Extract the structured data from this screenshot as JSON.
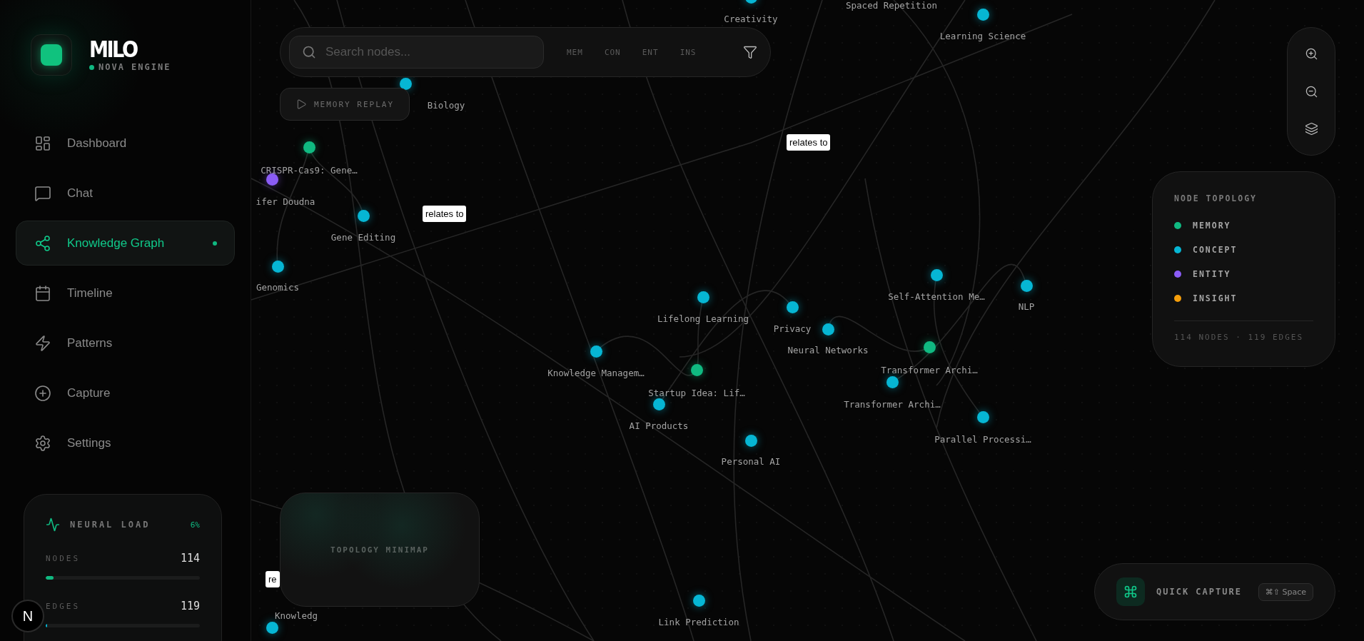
{
  "brand": {
    "title": "MILO",
    "subtitle": "NOVA ENGINE"
  },
  "nav": [
    {
      "label": "Dashboard",
      "selected": false
    },
    {
      "label": "Chat",
      "selected": false
    },
    {
      "label": "Knowledge Graph",
      "selected": true
    },
    {
      "label": "Timeline",
      "selected": false
    },
    {
      "label": "Patterns",
      "selected": false
    },
    {
      "label": "Capture",
      "selected": false
    },
    {
      "label": "Settings",
      "selected": false
    }
  ],
  "neural_load": {
    "title": "NEURAL LOAD",
    "percent": "6%",
    "meters": [
      {
        "label": "NODES",
        "value": "114",
        "level": 0.05,
        "color": "#10b981"
      },
      {
        "label": "EDGES",
        "value": "119",
        "level": 0.01,
        "color": "#06b6d4"
      }
    ]
  },
  "dev_badge": "N",
  "search": {
    "placeholder": "Search nodes..."
  },
  "filters": [
    "MEM",
    "CON",
    "ENT",
    "INS"
  ],
  "replay_button": "MEMORY REPLAY",
  "graph": {
    "nodes": [
      {
        "label": "Creativity",
        "color": "#06b6d4"
      },
      {
        "label": "Spaced Repetition"
      },
      {
        "label": "Learning Science",
        "color": "#06b6d4"
      },
      {
        "label": "Biology",
        "color": "#06b6d4"
      },
      {
        "label": "CRISPR-Cas9: Gene…",
        "color": "#10b981"
      },
      {
        "label": "ifer Doudna",
        "color": "#8b5cf6"
      },
      {
        "label": "Gene Editing",
        "color": "#06b6d4"
      },
      {
        "label": "Genomics",
        "color": "#06b6d4"
      },
      {
        "label": "Lifelong Learning",
        "color": "#06b6d4"
      },
      {
        "label": "Privacy",
        "color": "#06b6d4"
      },
      {
        "label": "Neural Networks",
        "color": "#06b6d4"
      },
      {
        "label": "Self-Attention Me…",
        "color": "#06b6d4"
      },
      {
        "label": "NLP",
        "color": "#06b6d4"
      },
      {
        "label": "Transformer Archi…",
        "color": "#10b981"
      },
      {
        "label": "Transformer Archi…",
        "color": "#06b6d4"
      },
      {
        "label": "Parallel Processi…",
        "color": "#06b6d4"
      },
      {
        "label": "Knowledge Managem…",
        "color": "#06b6d4"
      },
      {
        "label": "Startup Idea: Lif…",
        "color": "#10b981"
      },
      {
        "label": "AI Products",
        "color": "#06b6d4"
      },
      {
        "label": "Personal AI",
        "color": "#06b6d4"
      },
      {
        "label": "Link Prediction",
        "color": "#06b6d4"
      },
      {
        "label": "Knowledg",
        "color": "#06b6d4"
      }
    ],
    "edge_labels": [
      "relates to",
      "relates to",
      "re"
    ]
  },
  "minimap": {
    "title": "TOPOLOGY MINIMAP"
  },
  "legend": {
    "title": "NODE TOPOLOGY",
    "items": [
      {
        "label": "MEMORY",
        "color": "#10b981"
      },
      {
        "label": "CONCEPT",
        "color": "#06b6d4"
      },
      {
        "label": "ENTITY",
        "color": "#8b5cf6"
      },
      {
        "label": "INSIGHT",
        "color": "#f59e0b"
      }
    ],
    "footer": "114 NODES · 119 EDGES"
  },
  "quick_capture": {
    "label": "QUICK CAPTURE",
    "shortcut": "⌘⇧ Space"
  }
}
